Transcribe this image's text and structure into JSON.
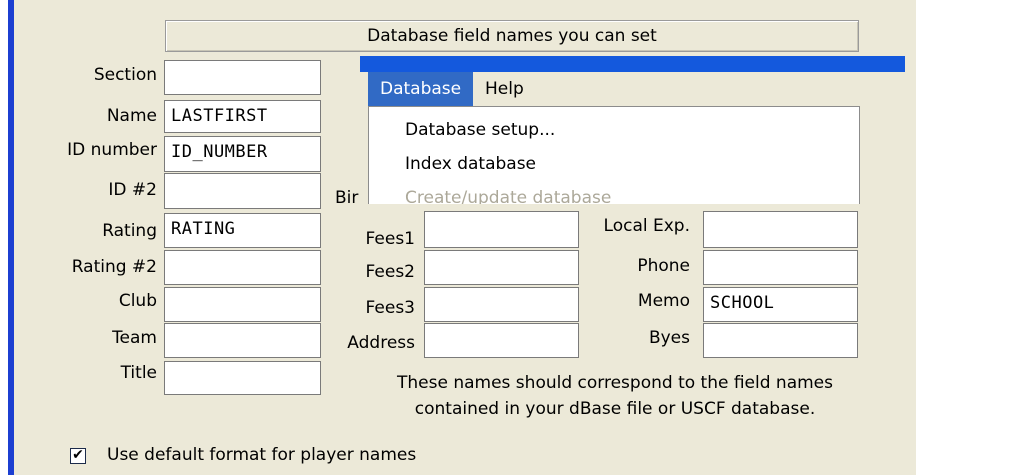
{
  "header": {
    "title": "Database field names you can set"
  },
  "left_fields": [
    {
      "label": "Section",
      "value": ""
    },
    {
      "label": "Name",
      "value": "LASTFIRST"
    },
    {
      "label": "ID number",
      "value": "ID_NUMBER"
    },
    {
      "label": "ID #2",
      "value": ""
    },
    {
      "label": "Rating",
      "value": "RATING"
    },
    {
      "label": "Rating #2",
      "value": ""
    },
    {
      "label": "Club",
      "value": ""
    },
    {
      "label": "Team",
      "value": ""
    },
    {
      "label": "Title",
      "value": ""
    }
  ],
  "middle_fields": [
    {
      "label": "Fees1",
      "value": ""
    },
    {
      "label": "Fees2",
      "value": ""
    },
    {
      "label": "Fees3",
      "value": ""
    },
    {
      "label": "Address",
      "value": ""
    }
  ],
  "right_fields": [
    {
      "label": "Local Exp.",
      "value": ""
    },
    {
      "label": "Phone",
      "value": ""
    },
    {
      "label": "Memo",
      "value": "SCHOOL"
    },
    {
      "label": "Byes",
      "value": ""
    }
  ],
  "partial_label_birth": "Bir",
  "note": {
    "line1": "These names should correspond to the field names",
    "line2": "contained in your dBase file or USCF database."
  },
  "checkbox": {
    "label": "Use default format for player names",
    "checked": true,
    "mark": "✔"
  },
  "menu": {
    "items": [
      "Database",
      "Help"
    ],
    "dropdown": [
      {
        "label": "Database setup...",
        "enabled": true
      },
      {
        "label": "Index database",
        "enabled": true
      },
      {
        "label": "Create/update database",
        "enabled": false
      }
    ]
  }
}
